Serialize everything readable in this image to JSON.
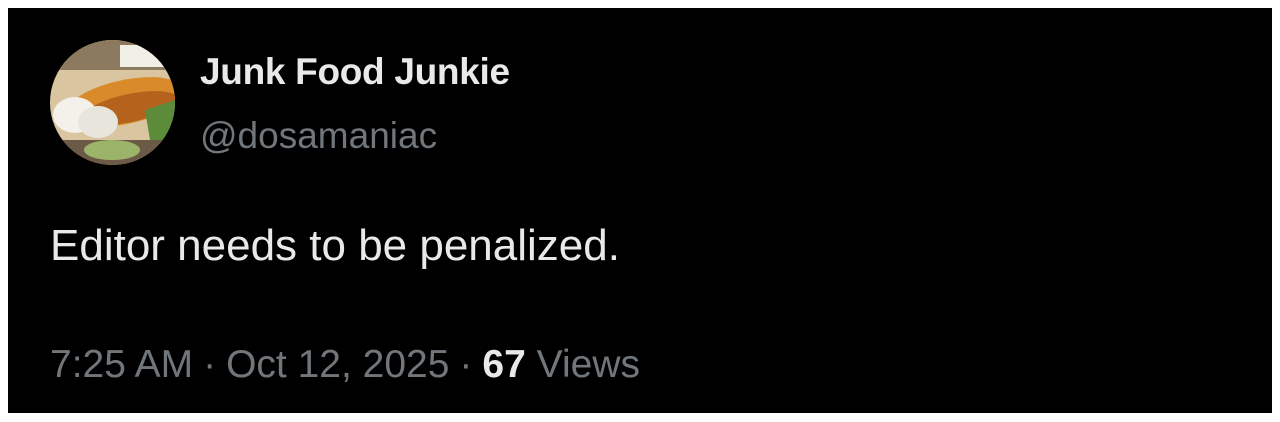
{
  "author": {
    "display_name": "Junk Food Junkie",
    "handle": "@dosamaniac",
    "avatar_icon": "food-platter-avatar"
  },
  "tweet": {
    "text": "Editor needs to be penalized."
  },
  "meta": {
    "time": "7:25 AM",
    "separator": "·",
    "date": "Oct 12, 2025",
    "views_count": "67",
    "views_label": "Views"
  },
  "colors": {
    "background": "#000000",
    "primary_text": "#e7e9ea",
    "secondary_text": "#71767b"
  }
}
